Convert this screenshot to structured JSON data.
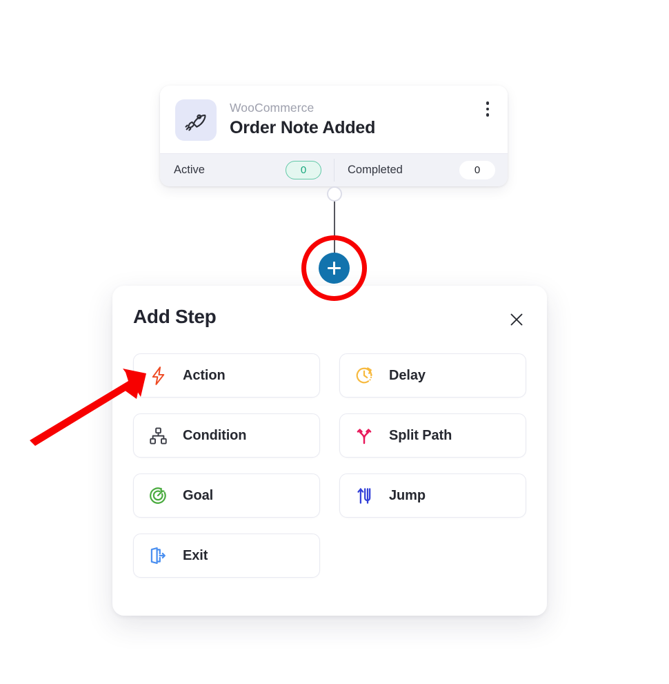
{
  "trigger_card": {
    "app_name": "WooCommerce",
    "title": "Order Note Added",
    "app_icon": "rocket-icon",
    "menu_icon": "kebab-menu-icon",
    "stats": [
      {
        "label": "Active",
        "value": "0",
        "style": "active"
      },
      {
        "label": "Completed",
        "value": "0",
        "style": "completed"
      }
    ]
  },
  "add_button": {
    "icon": "plus-icon",
    "color": "#1273ad"
  },
  "annotations": {
    "ring_color": "#f70000",
    "arrow_color": "#f70000",
    "arrow_target": "Action"
  },
  "panel": {
    "title": "Add Step",
    "close_icon": "close-icon",
    "options": [
      {
        "label": "Action",
        "icon": "lightning-bolt-icon",
        "color": "#ee4a23"
      },
      {
        "label": "Delay",
        "icon": "clock-icon",
        "color": "#f7b93e"
      },
      {
        "label": "Condition",
        "icon": "hierarchy-icon",
        "color": "#3b3d46"
      },
      {
        "label": "Split Path",
        "icon": "split-path-icon",
        "color": "#e8185a"
      },
      {
        "label": "Goal",
        "icon": "target-icon",
        "color": "#4aab3f"
      },
      {
        "label": "Jump",
        "icon": "jump-arrows-icon",
        "color": "#3340d8"
      },
      {
        "label": "Exit",
        "icon": "exit-door-icon",
        "color": "#4a8ff0"
      }
    ]
  }
}
